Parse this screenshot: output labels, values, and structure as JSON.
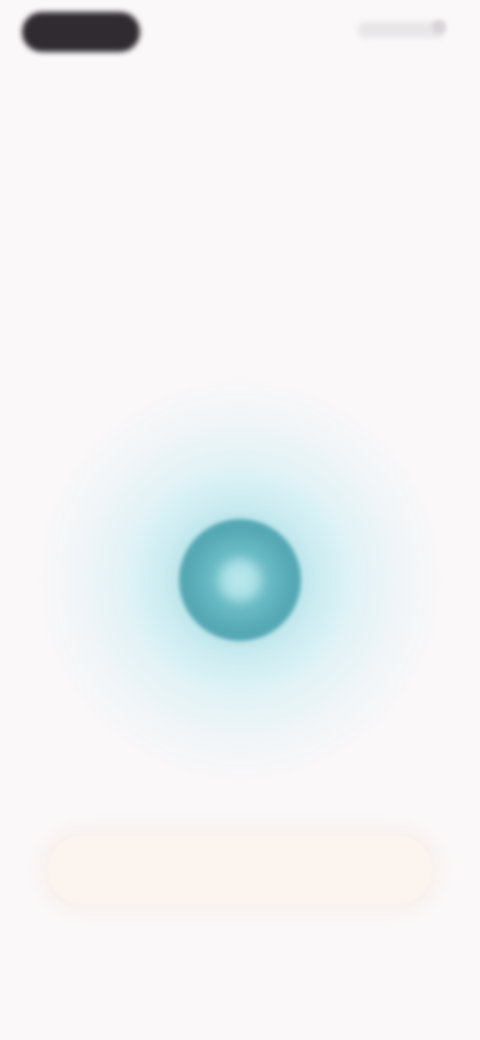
{
  "status_bar": {
    "left_icon": "status-pill",
    "right_icon": "status-indicators"
  },
  "main": {
    "title": "",
    "description": ""
  },
  "visual": {
    "core_color": "#5aabb7",
    "ring_color": "#dcf2f5"
  },
  "cta": {
    "label": ""
  }
}
